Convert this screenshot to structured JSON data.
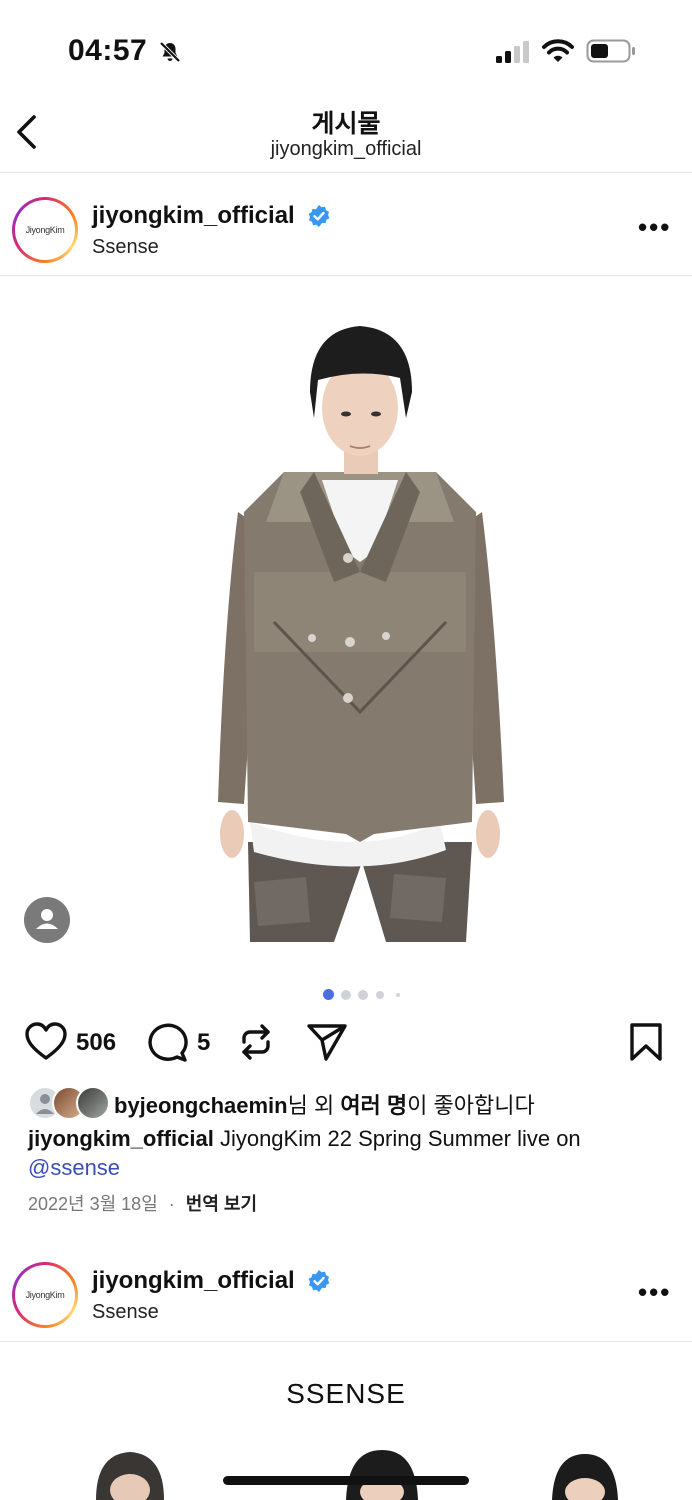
{
  "status_bar": {
    "time": "04:57"
  },
  "header": {
    "title": "게시물",
    "subtitle": "jiyongkim_official"
  },
  "post": {
    "avatar_text": "JiyongKim",
    "username": "jiyongkim_official",
    "location": "Ssense",
    "likes_count": "506",
    "comments_count": "5",
    "liked_by_user": "byjeongchaemin",
    "liked_by_mid": "님 외 ",
    "liked_by_others": "여러 명",
    "liked_by_suffix": "이 좋아합니다",
    "caption_user": "jiyongkim_official",
    "caption_text": "JiyongKim 22 Spring Summer live on",
    "caption_mention": "@ssense",
    "date": "2022년 3월 18일",
    "separator": "·",
    "translate": "번역 보기"
  },
  "next_post": {
    "avatar_text": "JiyongKim",
    "username": "jiyongkim_official",
    "location": "Ssense",
    "image_brand": "SSENSE"
  },
  "carousel": {
    "total": 5,
    "active": 1
  },
  "colors": {
    "verified": "#3897f0",
    "mention": "#3a4fb3",
    "active_dot": "#4a6fe3"
  },
  "icons": [
    "back-arrow-icon",
    "bell-muted-icon",
    "signal-icon",
    "wifi-icon",
    "battery-icon",
    "verified-icon",
    "more-icon",
    "person-icon",
    "heart-icon",
    "comment-icon",
    "repost-icon",
    "share-icon",
    "bookmark-icon"
  ]
}
